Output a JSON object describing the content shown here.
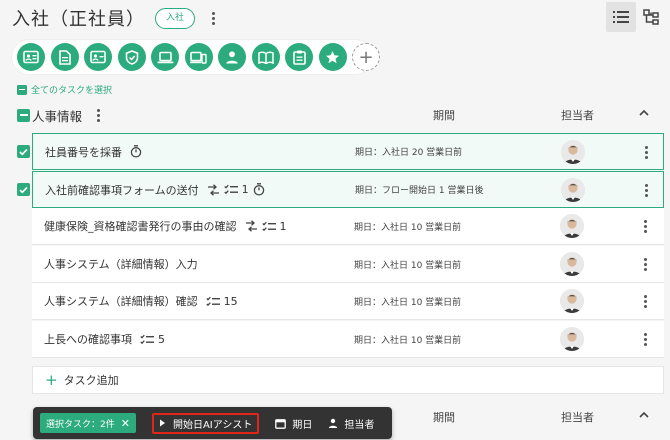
{
  "header": {
    "title": "入社（正社員）",
    "tag": "入社"
  },
  "category_icons": [
    "id-card-icon",
    "document-icon",
    "profile-card-icon",
    "shield-check-icon",
    "laptop-icon",
    "devices-icon",
    "person-icon",
    "book-icon",
    "clipboard-icon",
    "star-icon"
  ],
  "select_all_label": "全てのタスクを選択",
  "section": {
    "title": "人事情報",
    "col_period": "期間",
    "col_assignee": "担当者"
  },
  "tasks": [
    {
      "name": "社員番号を採番",
      "period": "期日：入社日 20 営業日前",
      "selected": true,
      "deps": false,
      "checklist": "",
      "timer": true
    },
    {
      "name": "入社前確認事項フォームの送付",
      "period": "期日：フロー開始日 1 営業日後",
      "selected": true,
      "deps": true,
      "checklist": "1",
      "timer": true
    },
    {
      "name": "健康保険_資格確認書発行の事由の確認",
      "period": "期日：入社日 10 営業日前",
      "selected": false,
      "deps": true,
      "checklist": "1",
      "timer": false
    },
    {
      "name": "人事システム（詳細情報）入力",
      "period": "期日：入社日 10 営業日前",
      "selected": false,
      "deps": false,
      "checklist": "",
      "timer": false
    },
    {
      "name": "人事システム（詳細情報）確認",
      "period": "期日：入社日 10 営業日前",
      "selected": false,
      "deps": false,
      "checklist": "15",
      "timer": false
    },
    {
      "name": "上長への確認事項",
      "period": "期日：入社日 10 営業日前",
      "selected": false,
      "deps": false,
      "checklist": "5",
      "timer": false
    }
  ],
  "add_task_label": "タスク追加",
  "lower_section": {
    "col_period": "期間",
    "col_assignee": "担当者"
  },
  "action_bar": {
    "selected_label": "選択タスク：2件",
    "ai_assist_label": "開始日AIアシスト",
    "due_label": "期日",
    "assignee_label": "担当者"
  },
  "colors": {
    "accent": "#2bab7e",
    "bar_bg": "#333333",
    "highlight_border": "#e0251b"
  }
}
